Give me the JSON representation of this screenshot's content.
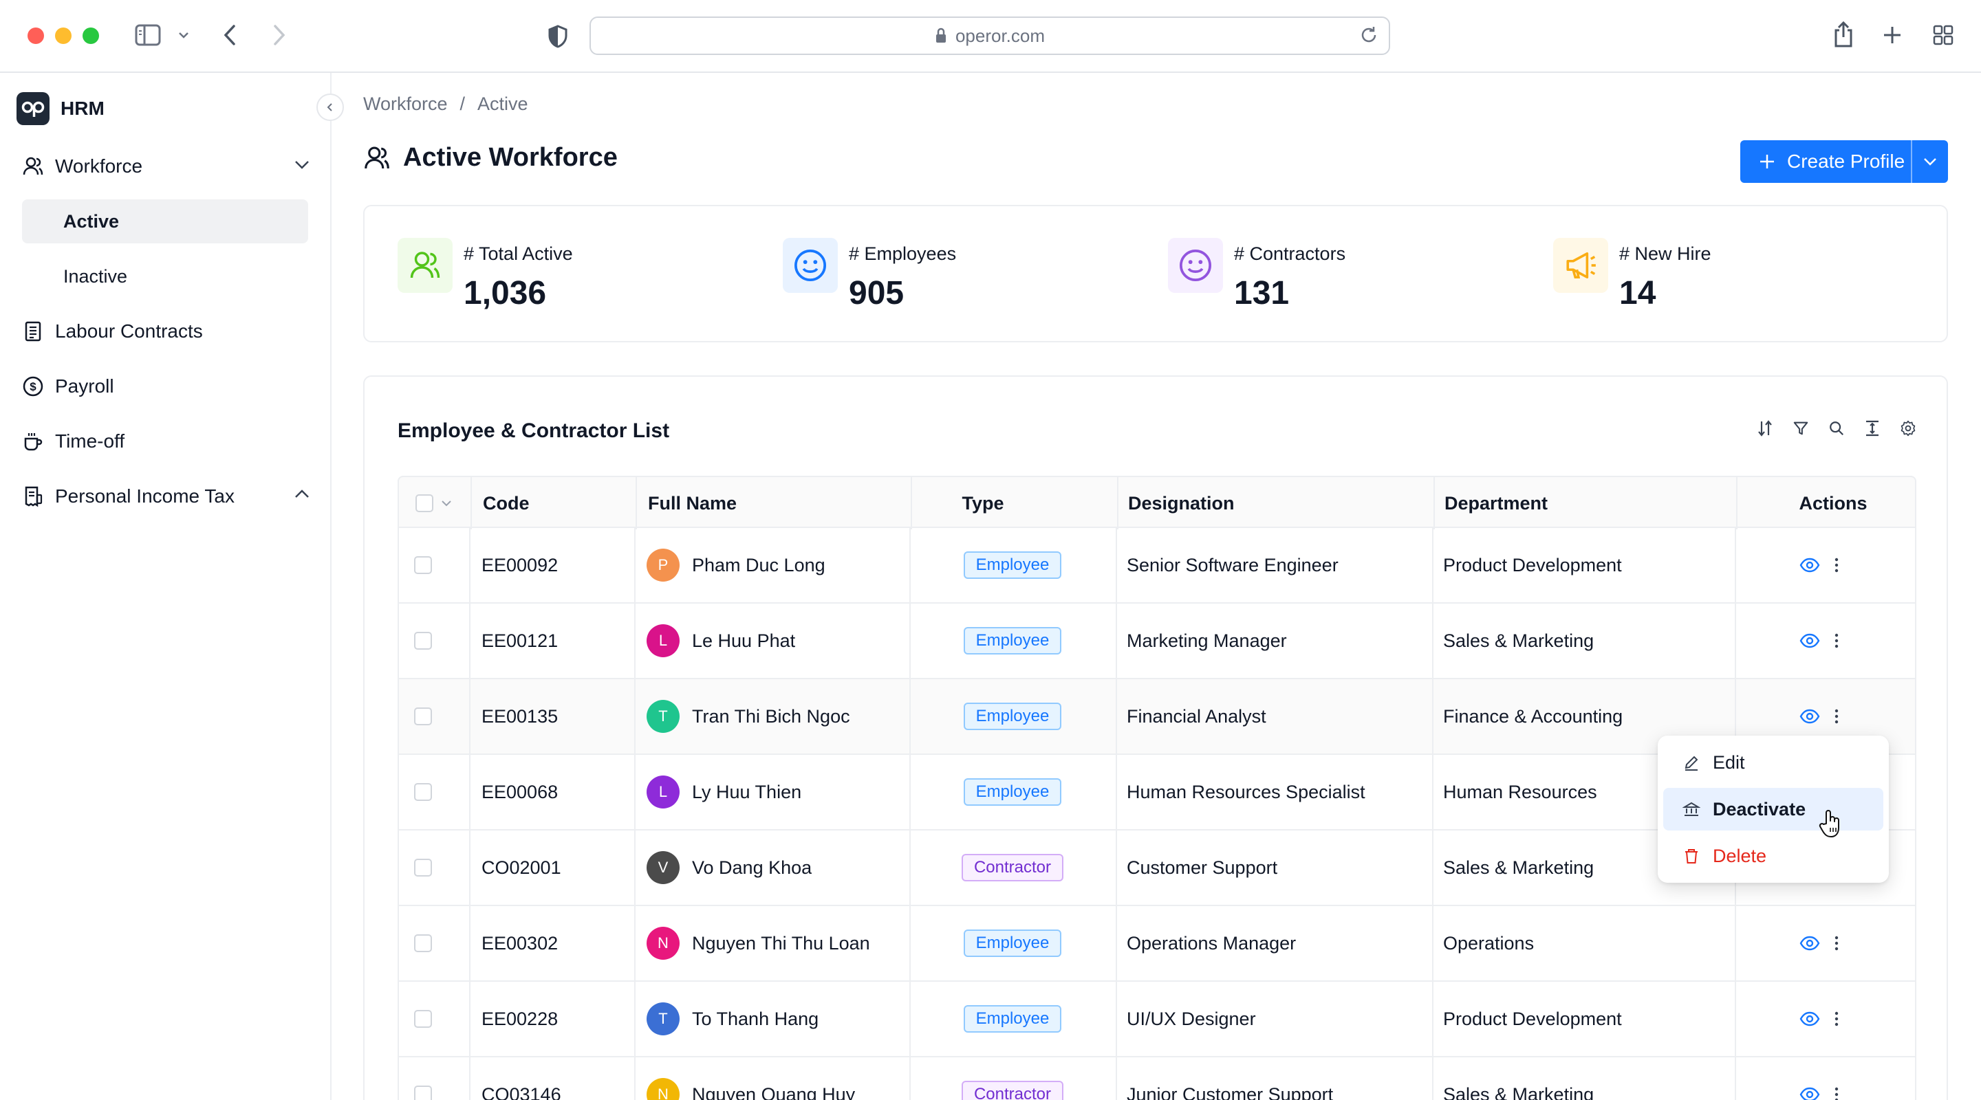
{
  "browser": {
    "url": "operor.com"
  },
  "sidebar": {
    "brand": "HRM",
    "brand_logo": "op",
    "items": [
      {
        "label": "Workforce",
        "icon": "users-icon",
        "expanded": true
      },
      {
        "label": "Labour Contracts",
        "icon": "document-icon"
      },
      {
        "label": "Payroll",
        "icon": "dollar-icon"
      },
      {
        "label": "Time-off",
        "icon": "coffee-icon"
      },
      {
        "label": "Personal Income Tax",
        "icon": "receipt-icon",
        "expanded": false
      }
    ],
    "workforce_sub": [
      {
        "label": "Active",
        "active": true
      },
      {
        "label": "Inactive",
        "active": false
      }
    ]
  },
  "breadcrumb": [
    "Workforce",
    "/",
    "Active"
  ],
  "page": {
    "title": "Active Workforce",
    "create_label": "Create Profile"
  },
  "stats": [
    {
      "label": "# Total Active",
      "value": "1,036",
      "icon": "users-icon",
      "color": "#52c41a",
      "bg": "#f0fbe9"
    },
    {
      "label": "# Employees",
      "value": "905",
      "icon": "smile-icon",
      "color": "#1677ff",
      "bg": "#e8f2ff"
    },
    {
      "label": "# Contractors",
      "value": "131",
      "icon": "smile-icon",
      "color": "#9254de",
      "bg": "#f6efff"
    },
    {
      "label": "# New Hire",
      "value": "14",
      "icon": "megaphone-icon",
      "color": "#faad14",
      "bg": "#fff8e6"
    }
  ],
  "list": {
    "title": "Employee & Contractor List",
    "columns": [
      "Code",
      "Full Name",
      "Type",
      "Designation",
      "Department",
      "Actions"
    ],
    "rows": [
      {
        "code": "EE00092",
        "name": "Pham Duc Long",
        "initial": "P",
        "avatar": "#f4924e",
        "type": "Employee",
        "designation": "Senior Software Engineer",
        "department": "Product Development"
      },
      {
        "code": "EE00121",
        "name": "Le Huu Phat",
        "initial": "L",
        "avatar": "#d9138a",
        "type": "Employee",
        "designation": "Marketing Manager",
        "department": "Sales & Marketing"
      },
      {
        "code": "EE00135",
        "name": "Tran Thi Bich Ngoc",
        "initial": "T",
        "avatar": "#1fc58e",
        "type": "Employee",
        "designation": "Financial Analyst",
        "department": "Finance & Accounting"
      },
      {
        "code": "EE00068",
        "name": "Ly Huu Thien",
        "initial": "L",
        "avatar": "#8e2bd9",
        "type": "Employee",
        "designation": "Human Resources Specialist",
        "department": "Human Resources"
      },
      {
        "code": "CO02001",
        "name": "Vo Dang Khoa",
        "initial": "V",
        "avatar": "#4b4b4b",
        "type": "Contractor",
        "designation": "Customer Support",
        "department": "Sales & Marketing"
      },
      {
        "code": "EE00302",
        "name": "Nguyen Thi Thu Loan",
        "initial": "N",
        "avatar": "#e8177d",
        "type": "Employee",
        "designation": "Operations Manager",
        "department": "Operations"
      },
      {
        "code": "EE00228",
        "name": "To Thanh Hang",
        "initial": "T",
        "avatar": "#3b6fd4",
        "type": "Employee",
        "designation": "UI/UX Designer",
        "department": "Product Development"
      },
      {
        "code": "CO03146",
        "name": "Nguyen Quang Huy",
        "initial": "N",
        "avatar": "#f2b705",
        "type": "Contractor",
        "designation": "Junior Customer Support",
        "department": "Sales & Marketing"
      }
    ]
  },
  "context_menu": {
    "items": [
      {
        "label": "Edit",
        "icon": "pencil-icon"
      },
      {
        "label": "Deactivate",
        "icon": "bank-icon",
        "active": true
      },
      {
        "label": "Delete",
        "icon": "trash-icon",
        "danger": true
      }
    ]
  }
}
